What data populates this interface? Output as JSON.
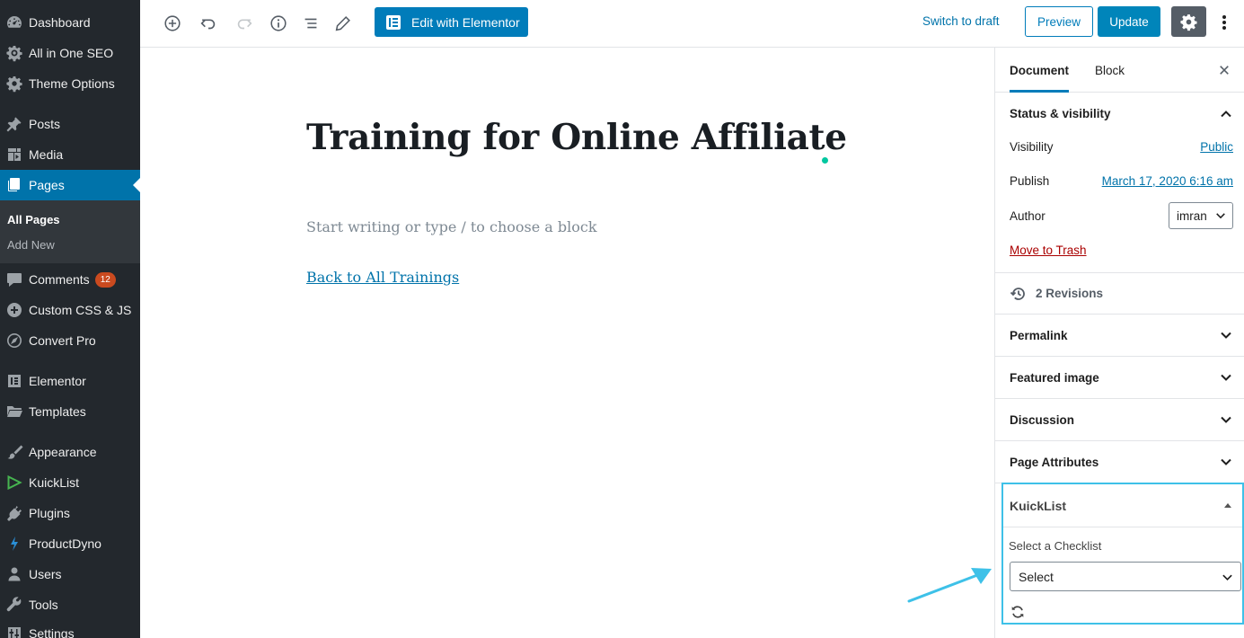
{
  "admin_menu": {
    "items": [
      {
        "label": "Dashboard",
        "icon": "dashboard-icon"
      },
      {
        "label": "All in One SEO",
        "icon": "seo-gear-icon"
      },
      {
        "label": "Theme Options",
        "icon": "gear-icon"
      },
      {
        "label": "Posts",
        "icon": "pushpin-icon"
      },
      {
        "label": "Media",
        "icon": "media-icon"
      },
      {
        "label": "Pages",
        "icon": "pages-icon"
      },
      {
        "label": "Comments",
        "icon": "comment-icon",
        "badge": "12"
      },
      {
        "label": "Custom CSS & JS",
        "icon": "plus-circle-icon"
      },
      {
        "label": "Convert Pro",
        "icon": "compass-icon"
      },
      {
        "label": "Elementor",
        "icon": "elementor-icon"
      },
      {
        "label": "Templates",
        "icon": "folder-icon"
      },
      {
        "label": "Appearance",
        "icon": "paintbrush-icon"
      },
      {
        "label": "KuickList",
        "icon": "play-triangle-icon"
      },
      {
        "label": "Plugins",
        "icon": "plug-icon"
      },
      {
        "label": "ProductDyno",
        "icon": "bolt-icon"
      },
      {
        "label": "Users",
        "icon": "user-icon"
      },
      {
        "label": "Tools",
        "icon": "wrench-icon"
      },
      {
        "label": "Settings",
        "icon": "settings-sliders-icon"
      }
    ],
    "active_item": "Pages",
    "submenu": [
      "All Pages",
      "Add New"
    ],
    "submenu_current": "All Pages"
  },
  "toolbar": {
    "elementor_label": "Edit with Elementor",
    "switch_to_draft": "Switch to draft",
    "preview": "Preview",
    "update": "Update"
  },
  "editor": {
    "title": "Training for Online Affiliate",
    "placeholder": "Start writing or type / to choose a block",
    "back_link": "Back to All Trainings"
  },
  "sidebar": {
    "tabs": [
      "Document",
      "Block"
    ],
    "active_tab": "Document",
    "status_section": {
      "title": "Status & visibility",
      "visibility_label": "Visibility",
      "visibility_value": "Public",
      "publish_label": "Publish",
      "publish_value": "March 17, 2020 6:16 am",
      "author_label": "Author",
      "author_value": "imran",
      "trash": "Move to Trash"
    },
    "revisions": "2 Revisions",
    "sections": [
      "Permalink",
      "Featured image",
      "Discussion",
      "Page Attributes"
    ],
    "kuicklist": {
      "title": "KuickList",
      "label": "Select a Checklist",
      "select_value": "Select"
    }
  },
  "colors": {
    "admin_bg": "#23282d",
    "admin_active": "#0073aa",
    "primary": "#007cba",
    "highlight": "#3ec1e8",
    "cursor_dot": "#00c7a0",
    "badge": "#ca4a1f"
  }
}
